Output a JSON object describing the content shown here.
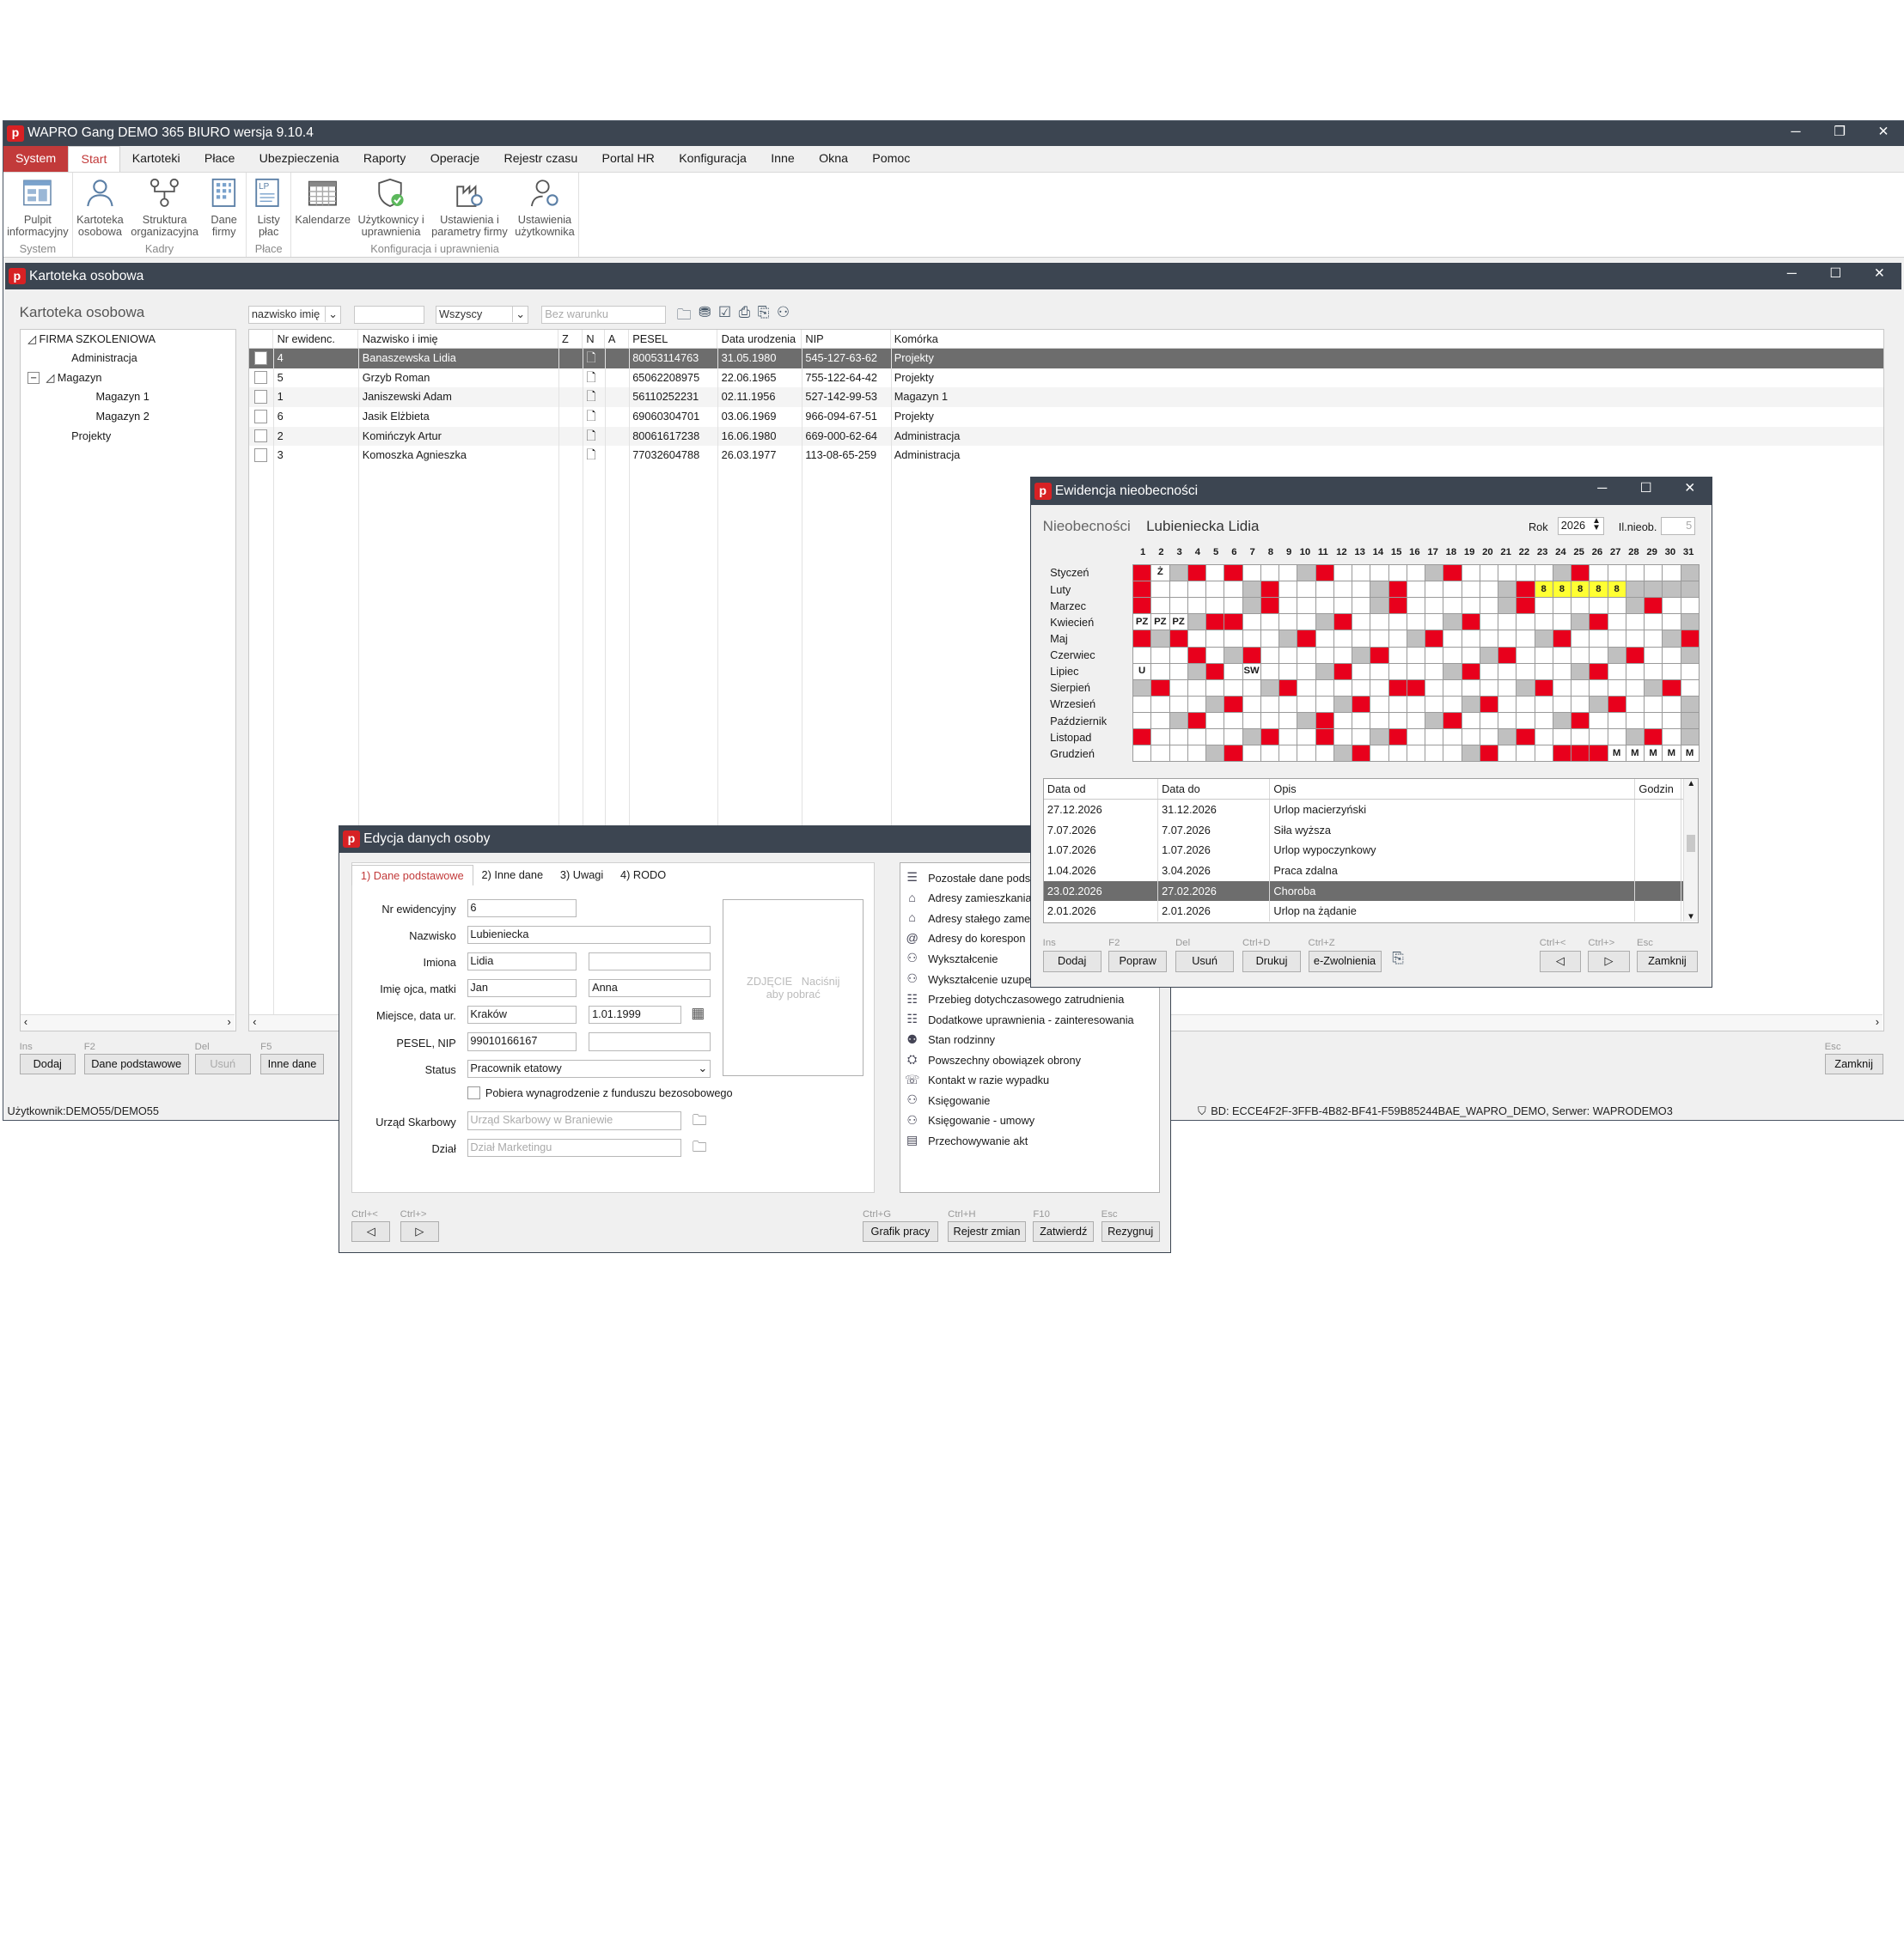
{
  "app": {
    "title": "WAPRO Gang DEMO 365 BIURO wersja 9.10.4",
    "logo": "p",
    "menu": [
      "System",
      "Start",
      "Kartoteki",
      "Płace",
      "Ubezpieczenia",
      "Raporty",
      "Operacje",
      "Rejestr czasu",
      "Portal HR",
      "Konfiguracja",
      "Inne",
      "Okna",
      "Pomoc"
    ],
    "ribbon": {
      "groups": [
        {
          "label": "System",
          "buttons": [
            {
              "label": "Pulpit\ninformacyjny",
              "icon": "dashboard-icon"
            }
          ]
        },
        {
          "label": "Kadry",
          "buttons": [
            {
              "label": "Kartoteka\nosobowa",
              "icon": "person-file-icon"
            },
            {
              "label": "Struktura\norganizacyjna",
              "icon": "org-structure-icon"
            },
            {
              "label": "Dane\nfirmy",
              "icon": "company-data-icon"
            }
          ]
        },
        {
          "label": "Płace",
          "buttons": [
            {
              "label": "Listy\npłac",
              "icon": "payroll-list-icon"
            }
          ]
        },
        {
          "label": "Konfiguracja i uprawnienia",
          "buttons": [
            {
              "label": "Kalendarze",
              "icon": "calendar-icon"
            },
            {
              "label": "Użytkownicy i\nuprawnienia",
              "icon": "users-permissions-icon"
            },
            {
              "label": "Ustawienia i\nparametry firmy",
              "icon": "company-settings-icon"
            },
            {
              "label": "Ustawienia\nużytkownika",
              "icon": "user-settings-icon"
            }
          ]
        }
      ]
    },
    "status_left": "Użytkownik:DEMO55/DEMO55",
    "status_right": "BD: ECCE4F2F-3FFB-4B82-BF41-F59B85244BAE_WAPRO_DEMO, Serwer: WAPRODEMO3"
  },
  "kartoteka": {
    "window_title": "Kartoteka osobowa",
    "heading": "Kartoteka osobowa",
    "sort_select": "nazwisko imię",
    "filter_select": "Wszyscy",
    "condition_placeholder": "Bez warunku",
    "tree": [
      {
        "label": "FIRMA SZKOLENIOWA",
        "level": 0,
        "expander": "◿"
      },
      {
        "label": "Administracja",
        "level": 1
      },
      {
        "label": "Magazyn",
        "level": 1,
        "expander": "◿",
        "minus": "−"
      },
      {
        "label": "Magazyn 1",
        "level": 2
      },
      {
        "label": "Magazyn 2",
        "level": 2
      },
      {
        "label": "Projekty",
        "level": 1
      }
    ],
    "columns": [
      "Nr ewidenc.",
      "Nazwisko i imię",
      "Z",
      "N",
      "A",
      "PESEL",
      "Data urodzenia",
      "NIP",
      "Komórka"
    ],
    "rows": [
      {
        "nr": "4",
        "name": "Banaszewska Lidia",
        "pesel": "80053114763",
        "birth": "31.05.1980",
        "nip": "545-127-63-62",
        "unit": "Projekty",
        "selected": true
      },
      {
        "nr": "5",
        "name": "Grzyb Roman",
        "pesel": "65062208975",
        "birth": "22.06.1965",
        "nip": "755-122-64-42",
        "unit": "Projekty"
      },
      {
        "nr": "1",
        "name": "Janiszewski Adam",
        "pesel": "56110252231",
        "birth": "02.11.1956",
        "nip": "527-142-99-53",
        "unit": "Magazyn 1"
      },
      {
        "nr": "6",
        "name": "Jasik Elżbieta",
        "pesel": "69060304701",
        "birth": "03.06.1969",
        "nip": "966-094-67-51",
        "unit": "Projekty"
      },
      {
        "nr": "2",
        "name": "Komińczyk Artur",
        "pesel": "80061617238",
        "birth": "16.06.1980",
        "nip": "669-000-62-64",
        "unit": "Administracja"
      },
      {
        "nr": "3",
        "name": "Komoszka Agnieszka",
        "pesel": "77032604788",
        "birth": "26.03.1977",
        "nip": "113-08-65-259",
        "unit": "Administracja"
      }
    ],
    "buttons": [
      {
        "hk": "Ins",
        "label": "Dodaj"
      },
      {
        "hk": "F2",
        "label": "Dane podstawowe"
      },
      {
        "hk": "Del",
        "label": "Usuń",
        "disabled": true
      },
      {
        "hk": "F5",
        "label": "Inne dane"
      }
    ],
    "close_hk": "Esc",
    "close_label": "Zamknij"
  },
  "edycja": {
    "title": "Edycja danych osoby",
    "tabs": [
      "1) Dane podstawowe",
      "2) Inne dane",
      "3) Uwagi",
      "4) RODO"
    ],
    "labels": {
      "nr": "Nr ewidencyjny",
      "nazwisko": "Nazwisko",
      "imiona": "Imiona",
      "imie_ojca": "Imię ojca, matki",
      "miejsce": "Miejsce, data ur.",
      "pesel": "PESEL, NIP",
      "status": "Status",
      "urzad": "Urząd Skarbowy",
      "dzial": "Dział"
    },
    "values": {
      "nr": "6",
      "nazwisko": "Lubieniecka",
      "imie1": "Lidia",
      "imie2": "",
      "ojciec": "Jan",
      "matka": "Anna",
      "miejsce": "Kraków",
      "data": "1.01.1999",
      "pesel": "99010166167",
      "nip": "",
      "status": "Pracownik etatowy"
    },
    "placeholders": {
      "urzad": "Urząd Skarbowy w Braniewie",
      "dzial": "Dział Marketingu"
    },
    "checkbox": "Pobiera wynagrodzenie z funduszu bezosobowego",
    "photo": "ZDJĘCIE   Naciśnij\naby pobrać",
    "side_items": [
      {
        "label": "Pozostałe dane pods",
        "icon": "document-list-icon"
      },
      {
        "label": "Adresy zamieszkania",
        "icon": "home-address-icon"
      },
      {
        "label": "Adresy stałego zame",
        "icon": "permanent-address-icon"
      },
      {
        "label": "Adresy do korespon",
        "icon": "mail-address-icon"
      },
      {
        "label": "Wykształcenie",
        "icon": "education-icon"
      },
      {
        "label": "Wykształcenie uzupe",
        "icon": "extra-education-icon"
      },
      {
        "label": "Przebieg dotychczasowego zatrudnienia",
        "icon": "employment-history-icon"
      },
      {
        "label": "Dodatkowe uprawnienia - zainteresowania",
        "icon": "additional-skills-icon"
      },
      {
        "label": "Stan rodzinny",
        "icon": "family-icon"
      },
      {
        "label": "Powszechny obowiązek obrony",
        "icon": "defense-duty-icon"
      },
      {
        "label": "Kontakt w razie wypadku",
        "icon": "emergency-contact-icon"
      },
      {
        "label": "Księgowanie",
        "icon": "accounting-icon"
      },
      {
        "label": "Księgowanie - umowy",
        "icon": "accounting-contracts-icon"
      },
      {
        "label": "Przechowywanie akt",
        "icon": "archive-icon"
      }
    ],
    "nav": [
      {
        "hk": "Ctrl+<"
      },
      {
        "hk": "Ctrl+>"
      }
    ],
    "buttons": [
      {
        "hk": "Ctrl+G",
        "label": "Grafik pracy"
      },
      {
        "hk": "Ctrl+H",
        "label": "Rejestr zmian"
      },
      {
        "hk": "F10",
        "label": "Zatwierdź"
      },
      {
        "hk": "Esc",
        "label": "Rezygnuj"
      }
    ]
  },
  "ewidencja": {
    "title": "Ewidencja nieobecności",
    "label": "Nieobecności",
    "person": "Lubieniecka Lidia",
    "rok_label": "Rok",
    "rok": "2026",
    "ilnieob_label": "Il.nieob.",
    "ilnieob": "5",
    "days": [
      "1",
      "2",
      "3",
      "4",
      "5",
      "6",
      "7",
      "8",
      "9",
      "10",
      "11",
      "12",
      "13",
      "14",
      "15",
      "16",
      "17",
      "18",
      "19",
      "20",
      "21",
      "22",
      "23",
      "24",
      "25",
      "26",
      "27",
      "28",
      "29",
      "30",
      "31"
    ],
    "months": [
      "Styczeń",
      "Luty",
      "Marzec",
      "Kwiecień",
      "Maj",
      "Czerwiec",
      "Lipiec",
      "Sierpień",
      "Wrzesień",
      "Październik",
      "Listopad",
      "Grudzień"
    ],
    "marks": [
      {
        "month": 0,
        "day": 2,
        "text": "Ż"
      },
      {
        "month": 1,
        "day": 23,
        "text": "8"
      },
      {
        "month": 1,
        "day": 24,
        "text": "8"
      },
      {
        "month": 1,
        "day": 25,
        "text": "8"
      },
      {
        "month": 1,
        "day": 26,
        "text": "8"
      },
      {
        "month": 1,
        "day": 27,
        "text": "8"
      },
      {
        "month": 3,
        "day": 1,
        "text": "PZ"
      },
      {
        "month": 3,
        "day": 2,
        "text": "PZ"
      },
      {
        "month": 3,
        "day": 3,
        "text": "PZ"
      },
      {
        "month": 6,
        "day": 1,
        "text": "U"
      },
      {
        "month": 6,
        "day": 7,
        "text": "SW"
      },
      {
        "month": 11,
        "day": 27,
        "text": "M"
      },
      {
        "month": 11,
        "day": 28,
        "text": "M"
      },
      {
        "month": 11,
        "day": 29,
        "text": "M"
      },
      {
        "month": 11,
        "day": 30,
        "text": "M"
      },
      {
        "month": 11,
        "day": 31,
        "text": "M"
      }
    ],
    "colors": {
      "holiday": "#e8001c",
      "weekend": "#c0c0c0",
      "absence": "#ffff33"
    },
    "list_columns": [
      "Data od",
      "Data do",
      "Opis",
      "Godzin"
    ],
    "list_rows": [
      {
        "od": "27.12.2026",
        "do": "31.12.2026",
        "opis": "Urlop macierzyński"
      },
      {
        "od": "7.07.2026",
        "do": "7.07.2026",
        "opis": "Siła wyższa"
      },
      {
        "od": "1.07.2026",
        "do": "1.07.2026",
        "opis": "Urlop wypoczynkowy"
      },
      {
        "od": "1.04.2026",
        "do": "3.04.2026",
        "opis": "Praca zdalna"
      },
      {
        "od": "23.02.2026",
        "do": "27.02.2026",
        "opis": "Choroba",
        "selected": true
      },
      {
        "od": "2.01.2026",
        "do": "2.01.2026",
        "opis": "Urlop na żądanie"
      }
    ],
    "buttons": [
      {
        "hk": "Ins",
        "label": "Dodaj"
      },
      {
        "hk": "F2",
        "label": "Popraw"
      },
      {
        "hk": "Del",
        "label": "Usuń"
      },
      {
        "hk": "Ctrl+D",
        "label": "Drukuj"
      },
      {
        "hk": "Ctrl+Z",
        "label": "e-Zwolnienia"
      }
    ],
    "nav": [
      {
        "hk": "Ctrl+<"
      },
      {
        "hk": "Ctrl+>"
      }
    ],
    "close_hk": "Esc",
    "close_label": "Zamknij"
  }
}
